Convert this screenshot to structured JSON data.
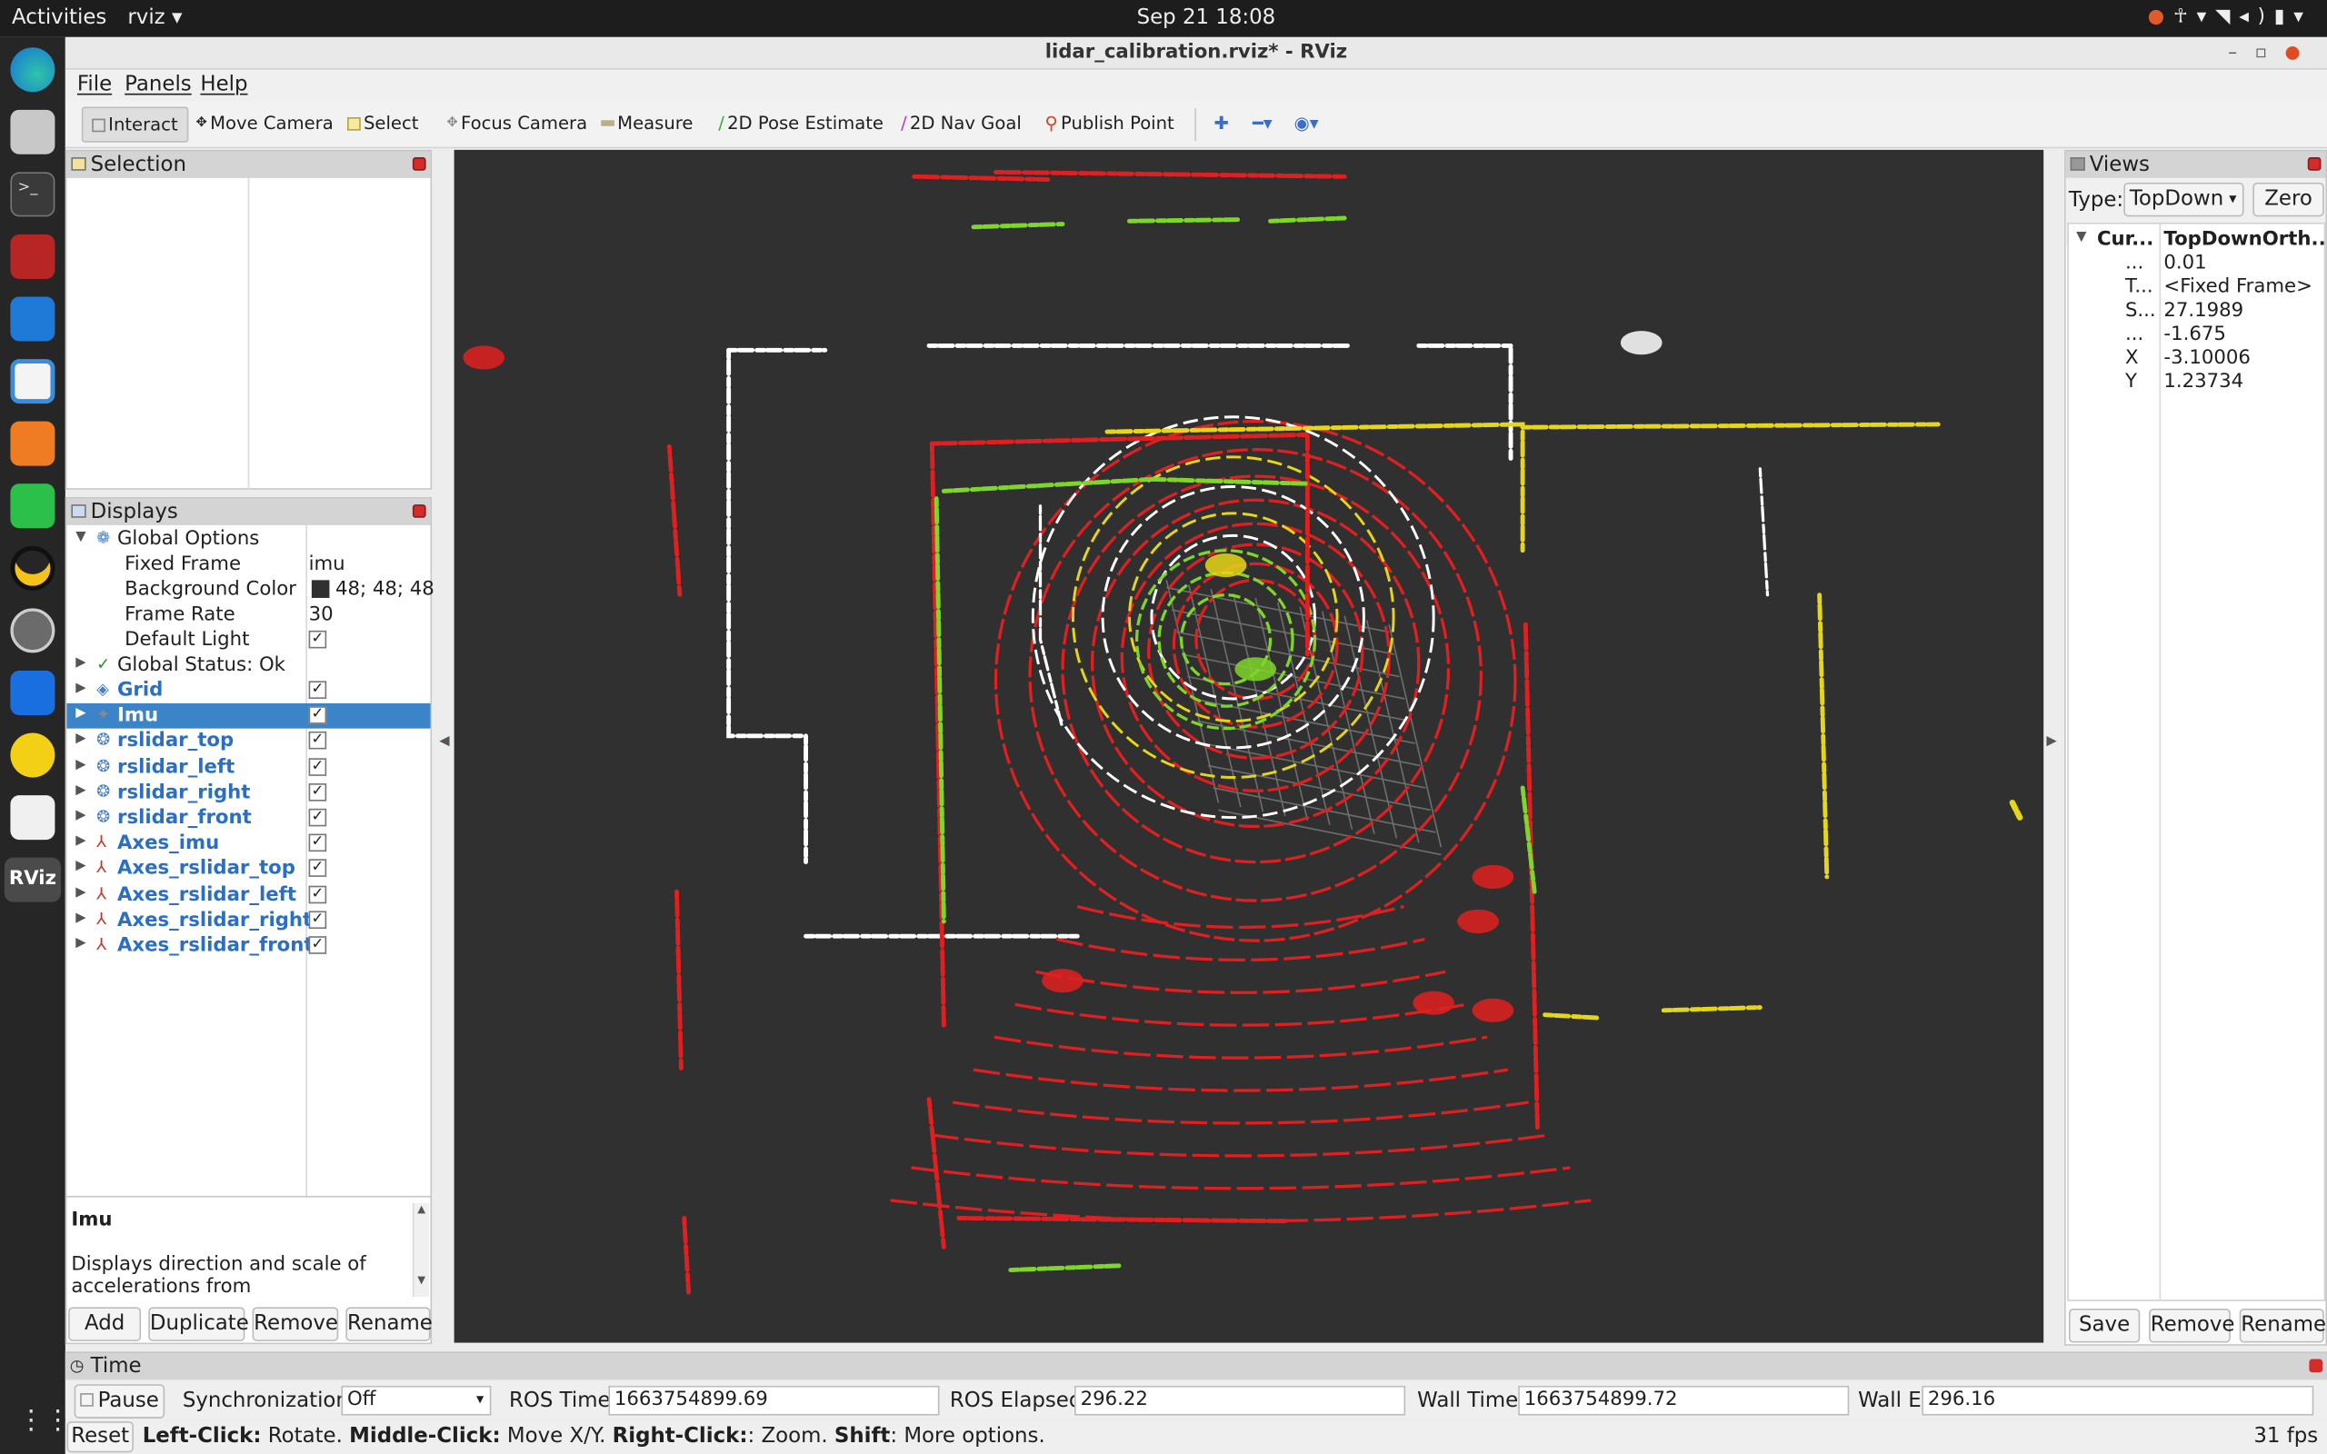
{
  "topbar": {
    "activities": "Activities",
    "app_name": "rviz",
    "clock": "Sep 21  18:08"
  },
  "window": {
    "title": "lidar_calibration.rviz* - RViz"
  },
  "menu": {
    "file": "File",
    "panels": "Panels",
    "help": "Help"
  },
  "toolbar": {
    "interact": "Interact",
    "move_camera": "Move Camera",
    "select": "Select",
    "focus_camera": "Focus Camera",
    "measure": "Measure",
    "pose_estimate": "2D Pose Estimate",
    "nav_goal": "2D Nav Goal",
    "publish_point": "Publish Point",
    "icons": [
      "plus-icon",
      "minus-icon",
      "eye-icon"
    ]
  },
  "selection_panel": {
    "title": "Selection"
  },
  "displays_panel": {
    "title": "Displays",
    "global_options": "Global Options",
    "fixed_frame_label": "Fixed Frame",
    "fixed_frame_value": "imu",
    "bg_color_label": "Background Color",
    "bg_color_value": "48; 48; 48",
    "frame_rate_label": "Frame Rate",
    "frame_rate_value": "30",
    "default_light_label": "Default Light",
    "global_status": "Global Status: Ok",
    "items": [
      "Grid",
      "Imu",
      "rslidar_top",
      "rslidar_left",
      "rslidar_right",
      "rslidar_front",
      "Axes_imu",
      "Axes_rslidar_top",
      "Axes_rslidar_left",
      "Axes_rslidar_right",
      "Axes_rslidar_front"
    ],
    "selected": "Imu",
    "description_title": "Imu",
    "description_text": "Displays direction and scale of accelerations from sensor_msgs/Imu",
    "buttons": {
      "add": "Add",
      "duplicate": "Duplicate",
      "remove": "Remove",
      "rename": "Rename"
    }
  },
  "views_panel": {
    "title": "Views",
    "type_label": "Type:",
    "type_value": "TopDown",
    "zero": "Zero",
    "current_label": "Cur...",
    "current_value": "TopDownOrth...",
    "rows": [
      {
        "k": "...",
        "v": "0.01"
      },
      {
        "k": "T...",
        "v": "<Fixed Frame>"
      },
      {
        "k": "S...",
        "v": "27.1989"
      },
      {
        "k": "...",
        "v": "-1.675"
      },
      {
        "k": "X",
        "v": "-3.10006"
      },
      {
        "k": "Y",
        "v": "1.23734"
      }
    ],
    "buttons": {
      "save": "Save",
      "remove": "Remove",
      "rename": "Rename"
    }
  },
  "time_panel": {
    "title": "Time",
    "pause": "Pause",
    "sync_label": "Synchronization:",
    "sync_value": "Off",
    "ros_time_label": "ROS Time:",
    "ros_time": "1663754899.69",
    "ros_elapsed_label": "ROS Elapsed:",
    "ros_elapsed": "296.22",
    "wall_time_label": "Wall Time:",
    "wall_time": "1663754899.72",
    "wall_elapsed_label": "Wall Elapsed:",
    "wall_elapsed": "296.16"
  },
  "statusbar": {
    "reset": "Reset",
    "left_click": "Left-Click:",
    "left_click_action": " Rotate. ",
    "middle_click": "Middle-Click:",
    "middle_click_action": " Move X/Y. ",
    "right_click": "Right-Click:",
    "right_click_action": ": Zoom. ",
    "shift": "Shift",
    "shift_action": ": More options.",
    "fps": "31 fps"
  },
  "colors": {
    "background": "#303030",
    "top_lidar": "#ffffff",
    "left_lidar": "#e02020",
    "right_lidar": "#e6d619",
    "front_lidar": "#7fd62a",
    "selection": "#3a84c7"
  }
}
